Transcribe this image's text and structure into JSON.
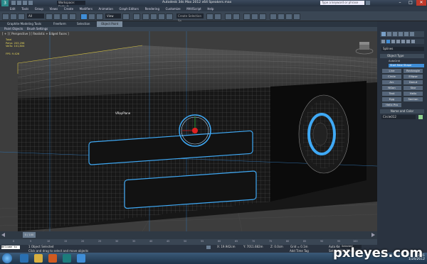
{
  "titlebar": {
    "app_logo": "3",
    "workspace": "Workspace: Default",
    "title": "Autodesk 3ds Max 2012 x64     Speakers.max",
    "search_placeholder": "Type a keyword or phrase",
    "window_buttons": [
      "–",
      "□",
      "✕"
    ]
  },
  "menu": [
    "Edit",
    "Tools",
    "Group",
    "Views",
    "Create",
    "Modifiers",
    "Animation",
    "Graph Editors",
    "Rendering",
    "Customize",
    "MAXScript",
    "Help"
  ],
  "toolbar": {
    "selection_filter": "All",
    "view_dropdown": "View",
    "named_sets": "Create Selection Se"
  },
  "ribbon": {
    "tabs": [
      "Graphite Modeling Tools",
      "Freeform",
      "Selection",
      "Object Paint"
    ],
    "active_tab": "Object Paint",
    "sub_items": [
      "Paint Objects",
      "Brush Settings"
    ]
  },
  "viewport": {
    "label": "[ + ] [ Perspective ] [ Realistic + Edged Faces ]",
    "stats": {
      "total_label": "Total",
      "polys_label": "Polys:",
      "polys": "203,296",
      "verts_label": "Verts:",
      "verts": "101,804",
      "fps_label": "FPS:",
      "fps": "9.426"
    },
    "object_label": "VRayPlane",
    "accent": "#3fa9f5",
    "gizmo_color": "#e02020"
  },
  "command_panel": {
    "category": "Splines",
    "rollout_title": "Object Type",
    "autogrid": "AutoGrid",
    "start_new_shape": "Start New Shape",
    "buttons": [
      "Line",
      "Rectangle",
      "Circle",
      "Ellipse",
      "Arc",
      "Donut",
      "NGon",
      "Star",
      "Text",
      "Helix",
      "Egg",
      "Section"
    ],
    "helix_button": "Helix Pro",
    "name_color_title": "Name and Color",
    "name_value": "Circle012",
    "swatch_color": "#8fd18f"
  },
  "timeline": {
    "frame_counter": "0 / 100",
    "ticks": [
      "0",
      "5",
      "10",
      "15",
      "20",
      "25",
      "30",
      "35",
      "40",
      "45",
      "50",
      "55",
      "60",
      "65",
      "70",
      "75",
      "80",
      "85",
      "90",
      "95",
      "100"
    ]
  },
  "status": {
    "listener": "Welcome to",
    "selected_text": "1 Object Selected",
    "prompt": "Click and drag to select and move objects",
    "x_label": "X:",
    "x": "19.942cm",
    "y_label": "Y:",
    "y": "7011.682m",
    "z_label": "Z:",
    "z": "0.0cm",
    "grid": "Grid = 0.1m",
    "auto_key": "Auto Key",
    "selected_dropdown": "Selected",
    "set_key": "Set Key",
    "key_filters": "Key Filters...",
    "add_time_tag": "Add Time Tag"
  },
  "taskbar": {
    "time": "12:01",
    "date": "1/24/2012"
  },
  "watermark": "pxleyes.com"
}
